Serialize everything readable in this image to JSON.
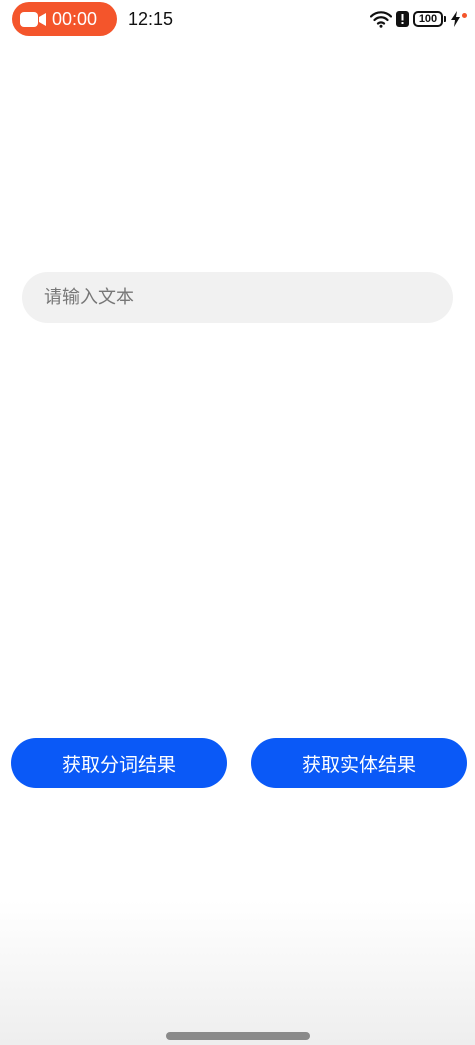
{
  "status_bar": {
    "recording_timer": "00:00",
    "clock": "12:15",
    "battery_level": "100",
    "icons": [
      "camera-icon",
      "wifi-icon",
      "alert-icon",
      "battery-icon",
      "charging-bolt-icon"
    ]
  },
  "input": {
    "value": "",
    "placeholder": "请输入文本"
  },
  "buttons": {
    "segment_label": "获取分词结果",
    "entity_label": "获取实体结果"
  },
  "colors": {
    "recording_pill": "#f4552b",
    "primary_button": "#0a59f7",
    "input_background": "#f1f1f1"
  }
}
